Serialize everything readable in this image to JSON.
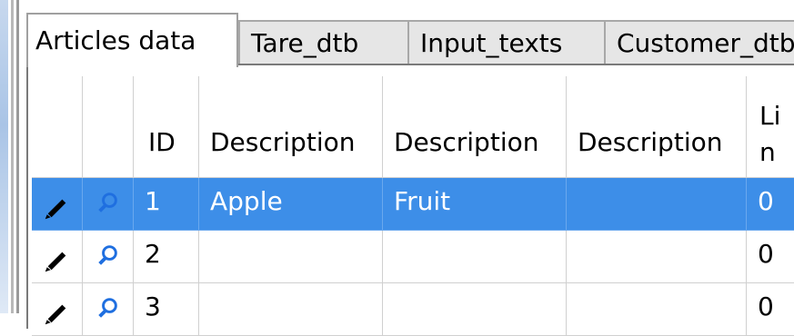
{
  "tabs": [
    {
      "label": "Articles data",
      "active": true
    },
    {
      "label": "Tare_dtb",
      "active": false
    },
    {
      "label": "Input_texts",
      "active": false
    },
    {
      "label": "Customer_dtb",
      "active": false
    }
  ],
  "grid": {
    "columns": [
      "",
      "",
      "ID",
      "Description",
      "Description",
      "Description",
      "Lin ta"
    ],
    "rows": [
      {
        "id": "1",
        "desc1": "Apple",
        "desc2": "Fruit",
        "desc3": "",
        "lin": "0",
        "selected": true
      },
      {
        "id": "2",
        "desc1": "",
        "desc2": "",
        "desc3": "",
        "lin": "0",
        "selected": false
      },
      {
        "id": "3",
        "desc1": "",
        "desc2": "",
        "desc3": "",
        "lin": "0",
        "selected": false
      }
    ],
    "icons": {
      "edit": "pencil-icon",
      "find": "magnifier-icon"
    }
  },
  "colors": {
    "selection": "#3d8ee8",
    "tab_inactive": "#e6e6e6",
    "grid_line": "#d0d0d0"
  }
}
